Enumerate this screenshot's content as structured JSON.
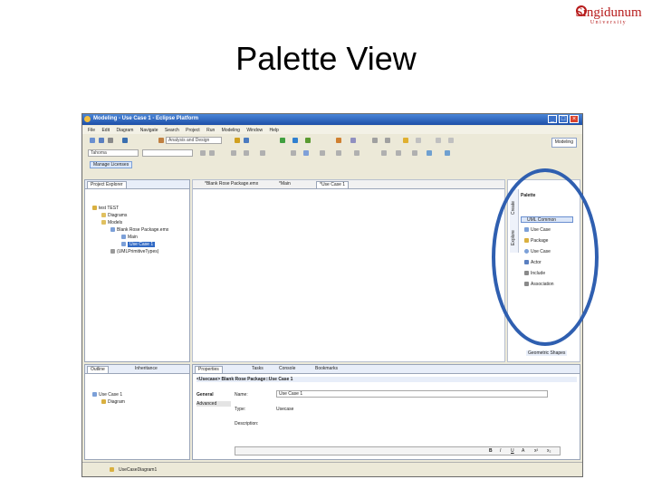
{
  "slide": {
    "title": "Palette View"
  },
  "logo": {
    "name": "Singidunum",
    "sub": "University"
  },
  "window": {
    "title": "Modeling - Use Case 1 - Eclipse Platform",
    "menus": [
      "File",
      "Edit",
      "Diagram",
      "Navigate",
      "Search",
      "Project",
      "Run",
      "Modeling",
      "Window",
      "Help"
    ],
    "toolbar_combo": "Analysis and Design",
    "font_combo": "Tahoma",
    "perspective": "Modeling",
    "manage_button": "Manage Licenses"
  },
  "explorer": {
    "tab": "Project Explorer",
    "items": [
      "test TEST",
      "Diagrams",
      "Models",
      "Blank Rose Package.emx",
      "Main",
      "Use Case 1",
      "(UMLPrimitiveTypes)"
    ]
  },
  "editor_tabs": [
    "*Blank Rose Package.emx",
    "*Main",
    "*Use Case 1"
  ],
  "palette": {
    "title": "Palette",
    "side_labels": [
      "Create",
      "Explore"
    ],
    "drawer": "UML Common",
    "items": [
      "Use Case",
      "Package",
      "Use Case",
      "Actor",
      "Include",
      "Association"
    ],
    "footer": "Geometric Shapes"
  },
  "outline": {
    "tabs": [
      "Outline",
      "Inheritance"
    ],
    "items": [
      "Use Case 1",
      "Diagram"
    ]
  },
  "properties": {
    "tabs": [
      "Properties",
      "Tasks",
      "Console",
      "Bookmarks"
    ],
    "header": "<Usecase> Blank Rose Package::Use Case 1",
    "sections": [
      "General",
      "Advanced"
    ],
    "fields": [
      {
        "label": "Name:",
        "value": "Use Case 1"
      },
      {
        "label": "Type:",
        "value": "Usecase"
      },
      {
        "label": "Description:",
        "value": ""
      }
    ],
    "format_buttons": [
      "B",
      "I",
      "U",
      "A",
      "x²",
      "x₂"
    ]
  },
  "status": {
    "text": "UseCaseDiagram1"
  },
  "colors": {
    "annotation": "#2f5fb0",
    "selection": "#316ac5",
    "titlebar": "#1d4fa8"
  }
}
